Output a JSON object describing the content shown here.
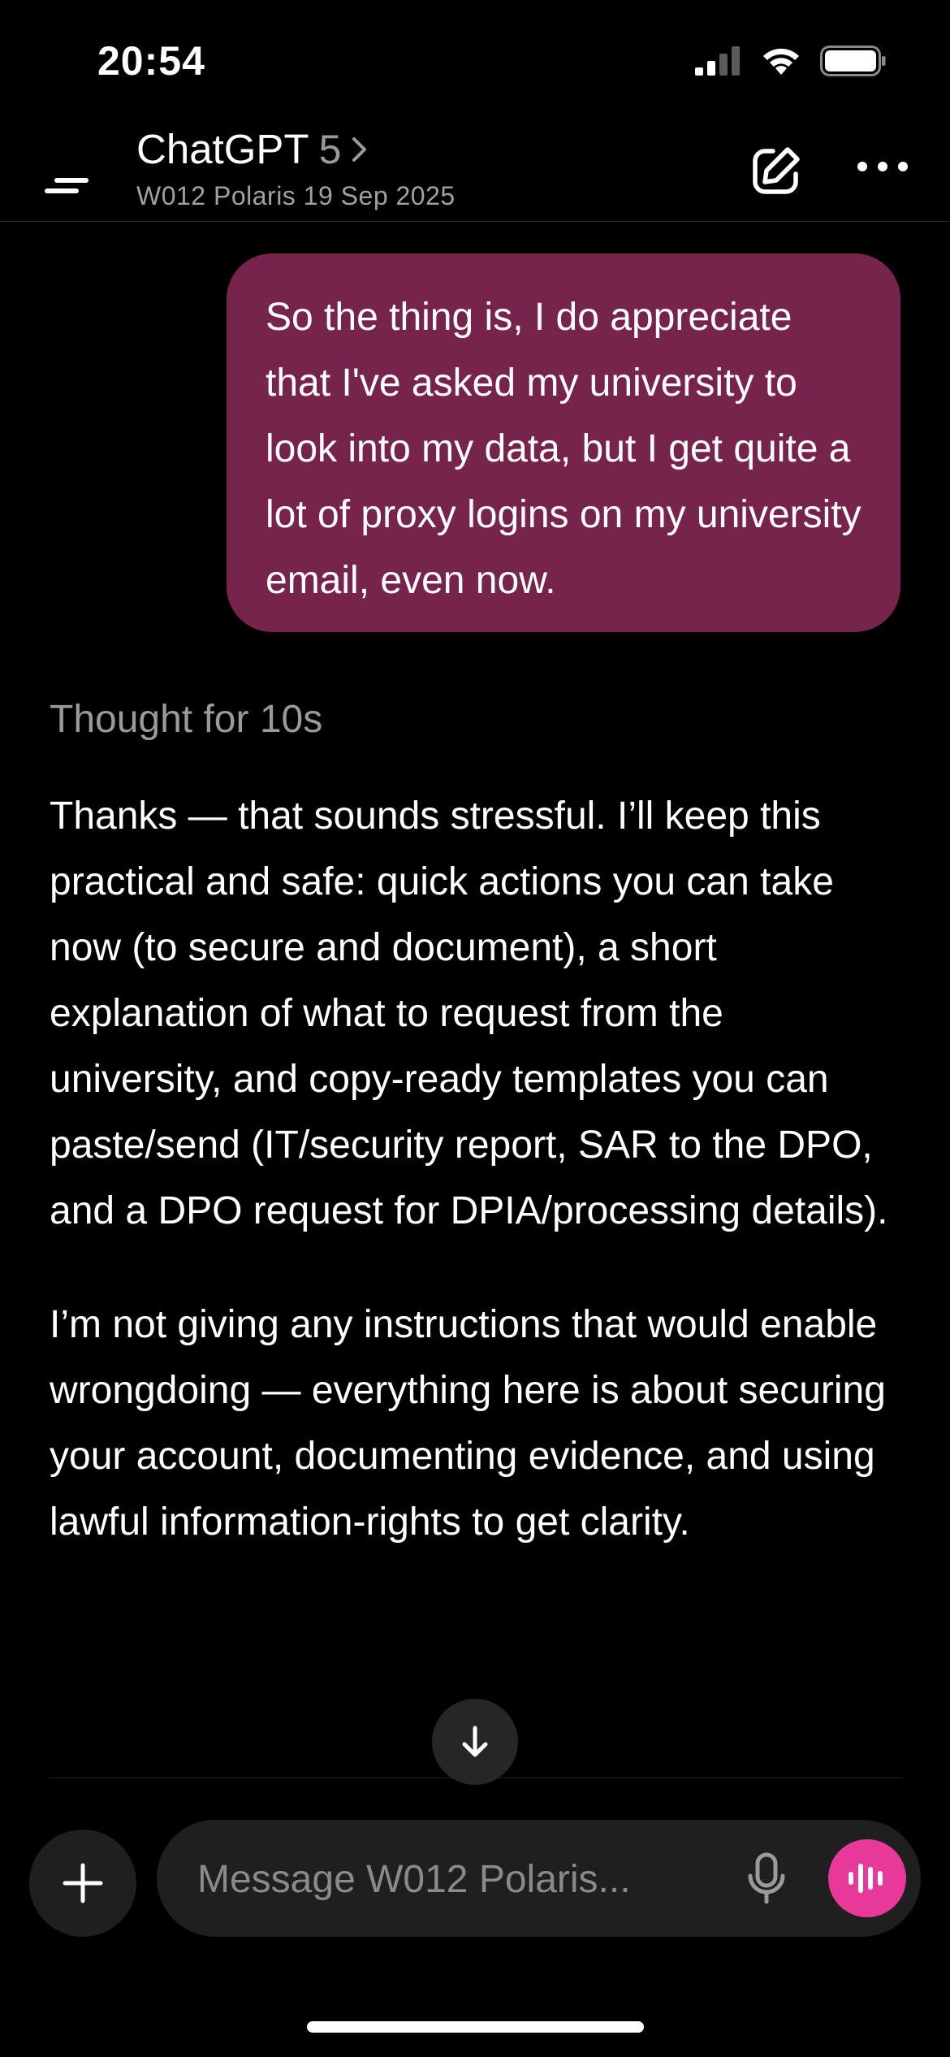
{
  "status_bar": {
    "time": "20:54"
  },
  "header": {
    "title": "ChatGPT",
    "version": "5",
    "subtitle": "W012 Polaris 19 Sep 2025"
  },
  "user_message": "So the thing is, I do appreciate that I've asked my university to look into my data, but I get quite a lot of proxy logins on my university email, even now.",
  "thought_label": "Thought for 10s",
  "assistant_paragraphs": [
    "Thanks — that sounds stressful. I’ll keep this practical and safe: quick actions you can take now (to secure and document), a short explanation of what to request from the university, and copy-ready templates you can paste/send (IT/security report, SAR to the DPO, and a DPO request for DPIA/processing details).",
    "I’m not giving any instructions that would enable wrongdoing — everything here is about securing your account, documenting evidence, and using lawful information-rights to get clarity."
  ],
  "composer": {
    "placeholder": "Message W012 Polaris..."
  },
  "icons": {
    "menu": "menu-icon",
    "chevron": "chevron-right-icon",
    "edit": "edit-icon",
    "more": "more-icon",
    "scroll": "arrow-down-icon",
    "plus": "plus-icon",
    "mic": "mic-icon",
    "voice": "voice-waveform-icon"
  },
  "colors": {
    "background": "#000000",
    "user_bubble": "#76244c",
    "accent_voice": "#e8389a",
    "composer_bg": "#1f1f1f"
  }
}
